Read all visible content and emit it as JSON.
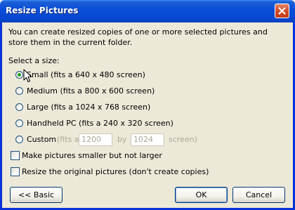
{
  "window": {
    "title": "Resize Pictures"
  },
  "description": "You can create resized copies of one or more selected pictures and store them in the current folder.",
  "size_section": {
    "label": "Select a size:",
    "options": [
      {
        "label": "Small (fits a 640 x 480 screen)",
        "selected": true,
        "enabled": true
      },
      {
        "label": "Medium (fits a 800 x 600 screen)",
        "selected": false,
        "enabled": true
      },
      {
        "label": "Large (fits a 1024 x 768 screen)",
        "selected": false,
        "enabled": true
      },
      {
        "label": "Handheld PC (fits a 240 x 320 screen)",
        "selected": false,
        "enabled": true
      }
    ],
    "custom": {
      "label": "Custom",
      "fits_a": "(fits a",
      "width_value": "1200",
      "by": "by",
      "height_value": "1024",
      "screen": "screen)",
      "enabled": false
    }
  },
  "checkboxes": [
    {
      "label": "Make pictures smaller but not larger",
      "checked": false
    },
    {
      "label": "Resize the original pictures (don't create copies)",
      "checked": false
    }
  ],
  "buttons": {
    "basic": "<< Basic",
    "ok": "OK",
    "cancel": "Cancel"
  },
  "colors": {
    "titlebar": "#0a4fd8",
    "dialog_bg": "#ece9d8",
    "close_button": "#d5502e",
    "radio_selected": "#21a121"
  }
}
